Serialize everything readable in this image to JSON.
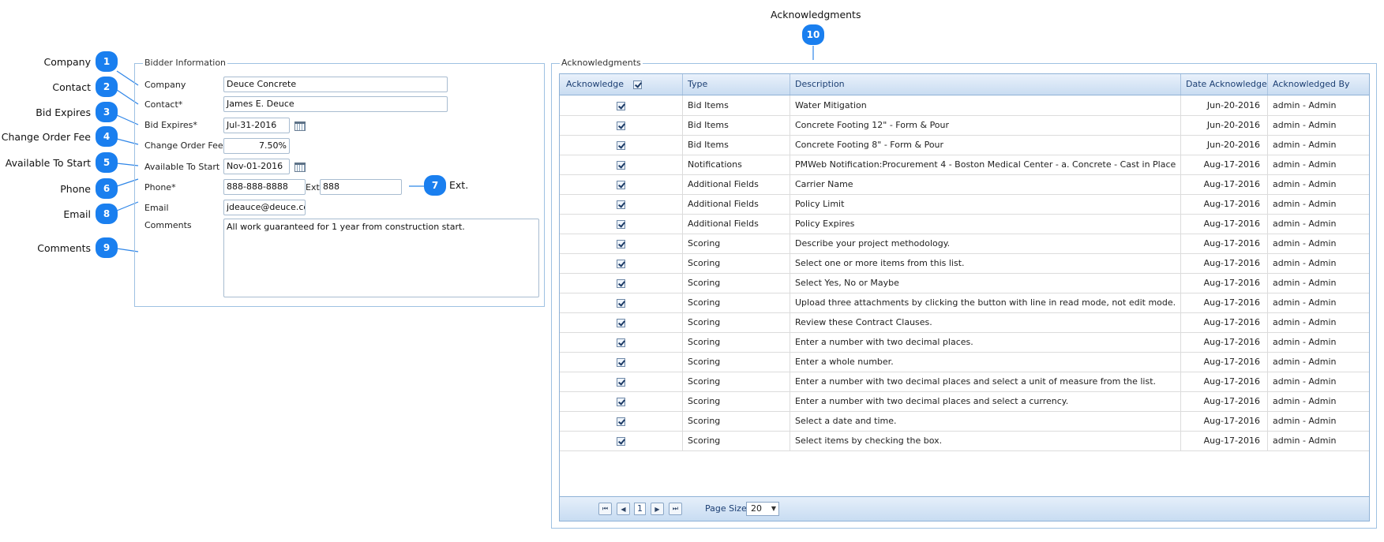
{
  "callouts": {
    "company": {
      "label": "Company",
      "num": "1"
    },
    "contact": {
      "label": "Contact",
      "num": "2"
    },
    "bid_expires": {
      "label": "Bid Expires",
      "num": "3"
    },
    "change_order_fee": {
      "label": "Change Order Fee",
      "num": "4"
    },
    "available_to_start": {
      "label": "Available To Start",
      "num": "5"
    },
    "phone": {
      "label": "Phone",
      "num": "6"
    },
    "ext": {
      "label": "Ext.",
      "num": "7"
    },
    "email": {
      "label": "Email",
      "num": "8"
    },
    "comments": {
      "label": "Comments",
      "num": "9"
    },
    "acknowledgments": {
      "label": "Acknowledgments",
      "num": "10"
    }
  },
  "bidder": {
    "title": "Bidder Information",
    "company_label": "Company",
    "company_value": "Deuce Concrete",
    "contact_label": "Contact*",
    "contact_value": "James E. Deuce",
    "bid_expires_label": "Bid Expires*",
    "bid_expires_value": "Jul-31-2016",
    "change_order_fee_label": "Change Order Fee",
    "change_order_fee_value": "7.50%",
    "available_label": "Available To Start",
    "available_value": "Nov-01-2016",
    "phone_label": "Phone*",
    "phone_value": "888-888-8888",
    "ext_label": "Ext.",
    "ext_value": "888",
    "email_label": "Email",
    "email_value": "jdeauce@deuce.co",
    "comments_label": "Comments",
    "comments_value": "All work guaranteed for 1 year from construction start."
  },
  "ack": {
    "title": "Acknowledgments",
    "columns": [
      "Acknowledge",
      "Type",
      "Description",
      "Date Acknowledged",
      "Acknowledged By"
    ],
    "rows": [
      {
        "type": "Bid Items",
        "description": "Water Mitigation",
        "date": "Jun-20-2016",
        "by": "admin - Admin"
      },
      {
        "type": "Bid Items",
        "description": "Concrete Footing 12\" - Form & Pour",
        "date": "Jun-20-2016",
        "by": "admin - Admin"
      },
      {
        "type": "Bid Items",
        "description": "Concrete Footing 8\" - Form & Pour",
        "date": "Jun-20-2016",
        "by": "admin - Admin"
      },
      {
        "type": "Notifications",
        "description": "PMWeb Notification:Procurement 4 - Boston Medical Center - a. Concrete - Cast in Place",
        "date": "Aug-17-2016",
        "by": "admin - Admin"
      },
      {
        "type": "Additional Fields",
        "description": "Carrier Name",
        "date": "Aug-17-2016",
        "by": "admin - Admin"
      },
      {
        "type": "Additional Fields",
        "description": "Policy Limit",
        "date": "Aug-17-2016",
        "by": "admin - Admin"
      },
      {
        "type": "Additional Fields",
        "description": "Policy Expires",
        "date": "Aug-17-2016",
        "by": "admin - Admin"
      },
      {
        "type": "Scoring",
        "description": "Describe your project methodology.",
        "date": "Aug-17-2016",
        "by": "admin - Admin"
      },
      {
        "type": "Scoring",
        "description": "Select one or more items from this list.",
        "date": "Aug-17-2016",
        "by": "admin - Admin"
      },
      {
        "type": "Scoring",
        "description": "Select Yes, No or Maybe",
        "date": "Aug-17-2016",
        "by": "admin - Admin"
      },
      {
        "type": "Scoring",
        "description": "Upload three attachments by clicking the button with line in read mode, not edit mode.",
        "date": "Aug-17-2016",
        "by": "admin - Admin"
      },
      {
        "type": "Scoring",
        "description": "Review these Contract Clauses.",
        "date": "Aug-17-2016",
        "by": "admin - Admin"
      },
      {
        "type": "Scoring",
        "description": "Enter a number with two decimal places.",
        "date": "Aug-17-2016",
        "by": "admin - Admin"
      },
      {
        "type": "Scoring",
        "description": "Enter a whole number.",
        "date": "Aug-17-2016",
        "by": "admin - Admin"
      },
      {
        "type": "Scoring",
        "description": "Enter a number with two decimal places and select a unit of measure from the list.",
        "date": "Aug-17-2016",
        "by": "admin - Admin"
      },
      {
        "type": "Scoring",
        "description": "Enter a number with two decimal places and select a currency.",
        "date": "Aug-17-2016",
        "by": "admin - Admin"
      },
      {
        "type": "Scoring",
        "description": "Select a date and time.",
        "date": "Aug-17-2016",
        "by": "admin - Admin"
      },
      {
        "type": "Scoring",
        "description": "Select items by checking the box.",
        "date": "Aug-17-2016",
        "by": "admin - Admin"
      }
    ],
    "pager": {
      "current_page": "1",
      "page_size_label": "Page Size",
      "page_size_value": "20"
    }
  }
}
